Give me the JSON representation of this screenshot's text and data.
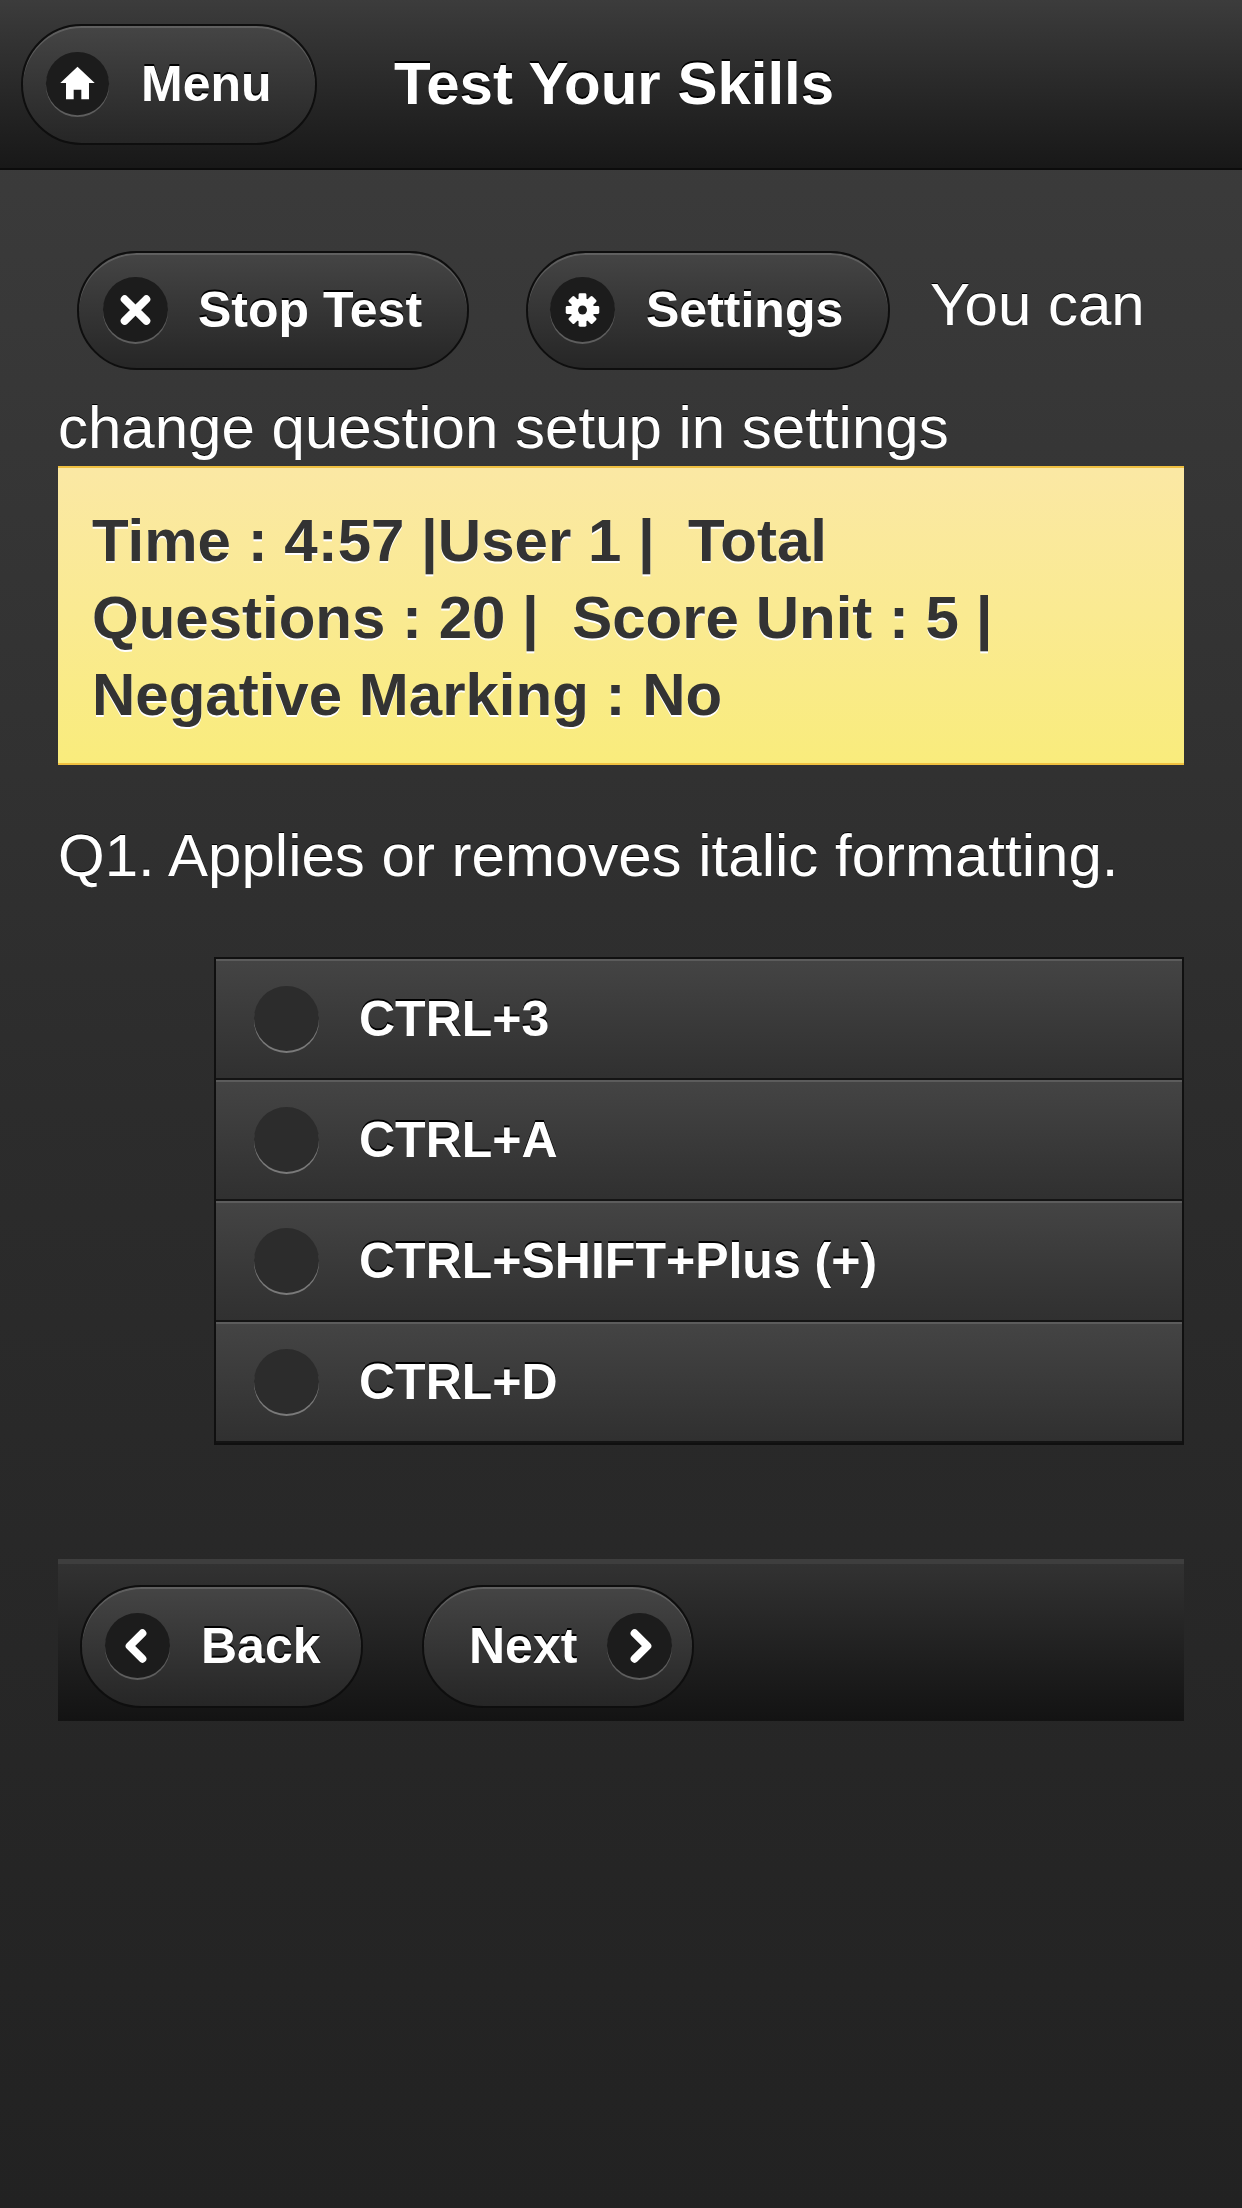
{
  "header": {
    "menu_button": "Menu",
    "title": "Test Your Skills"
  },
  "toolbar": {
    "buttons": [
      {
        "label": "Stop Test",
        "kind": "stop"
      },
      {
        "label": "Settings",
        "kind": "settings"
      }
    ],
    "hint": [
      "You can",
      "change question setup in settings"
    ]
  },
  "info_box": {
    "text": "Time : 4:57 |User 1 |  Total Questions : 20 |  Score Unit : 5 |  Negative Marking : No"
  },
  "question": {
    "text": "Q1. Applies or removes italic formatting.",
    "options": [
      {
        "label": "CTRL+3",
        "selected": false
      },
      {
        "label": "CTRL+A",
        "selected": false
      },
      {
        "label": "CTRL+SHIFT+Plus (+)",
        "selected": false
      },
      {
        "label": "CTRL+D",
        "selected": false
      }
    ]
  },
  "navigation": [
    {
      "label": "Back",
      "kind": "back"
    },
    {
      "label": "Next",
      "kind": "next"
    }
  ]
}
